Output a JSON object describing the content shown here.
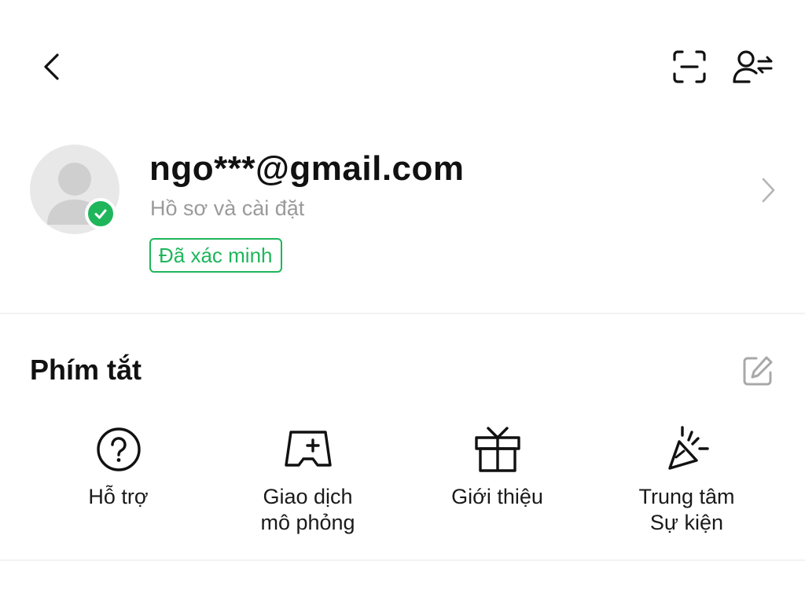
{
  "header": {
    "back_icon": "chevron-left-icon",
    "scan_icon": "scan-icon",
    "switch_account_icon": "user-switch-icon"
  },
  "profile": {
    "email": "ngo***@gmail.com",
    "subtitle": "Hồ sơ và cài đặt",
    "verified_label": "Đã xác minh",
    "accent_color": "#1fb65b"
  },
  "shortcuts": {
    "title": "Phím tắt",
    "items": [
      {
        "label": "Hỗ trợ",
        "icon": "help-circle-icon"
      },
      {
        "label": "Giao dịch\nmô phỏng",
        "icon": "demo-trading-icon"
      },
      {
        "label": "Giới thiệu",
        "icon": "gift-icon"
      },
      {
        "label": "Trung tâm\nSự kiện",
        "icon": "party-popper-icon"
      }
    ]
  }
}
